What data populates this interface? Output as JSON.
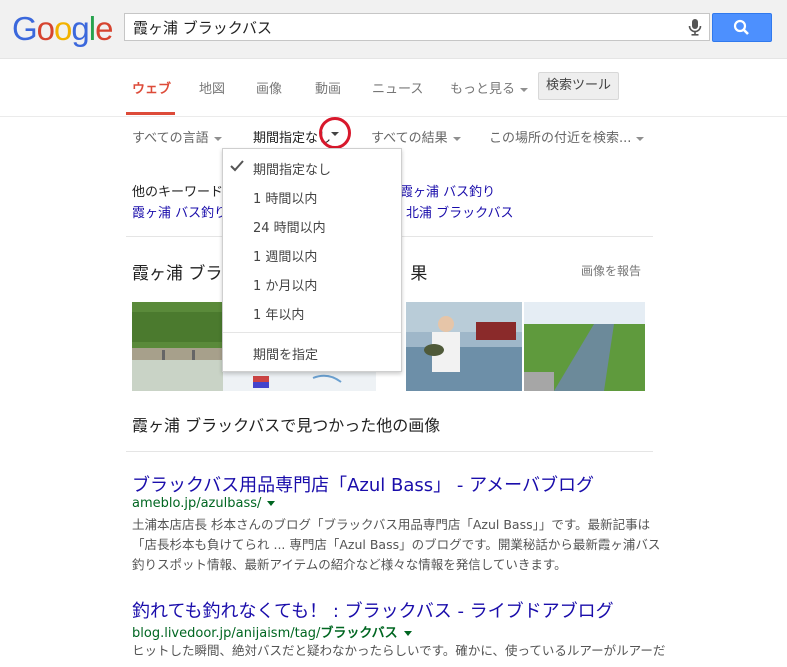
{
  "logo": {
    "letters": [
      "G",
      "o",
      "o",
      "g",
      "l",
      "e"
    ],
    "colors": [
      "#3b68dc",
      "#d6442f",
      "#f2b200",
      "#3b68dc",
      "#27a24d",
      "#d6442f"
    ]
  },
  "search": {
    "query": "霞ヶ浦 ブラックバス"
  },
  "tabs": [
    {
      "label": "ウェブ",
      "active": true
    },
    {
      "label": "地図"
    },
    {
      "label": "画像"
    },
    {
      "label": "動画"
    },
    {
      "label": "ニュース"
    },
    {
      "label": "もっと見る"
    }
  ],
  "tools_button": "検索ツール",
  "tool_filters": {
    "language": "すべての言語",
    "period": "期間指定なし",
    "results": "すべての結果",
    "location": "この場所の付近を検索..."
  },
  "period_menu": {
    "items": [
      "期間指定なし",
      "1 時間以内",
      "24 時間以内",
      "1 週間以内",
      "1 か月以内",
      "1 年以内"
    ],
    "custom": "期間を指定",
    "selected_index": 0
  },
  "related": {
    "label": "他のキーワード:",
    "items": [
      "霞ヶ浦 バス釣り",
      "霞ヶ浦 バス釣り",
      "北浦 ブラックバス"
    ]
  },
  "images": {
    "title_left": "霞ヶ浦 ブラ",
    "title_right": "果",
    "report": "画像を報告",
    "more": "霞ヶ浦 ブラックバスで見つかった他の画像"
  },
  "results": [
    {
      "title": "ブラックバス用品専門店「Azul Bass」 - アメーバブログ",
      "url": "ameblo.jp/azulbass/",
      "snippet": [
        "土浦本店店長 杉本さんのブログ「ブラックバス用品専門店「Azul Bass」」です。最新記事は",
        "「店長杉本も負けてられ ... 専門店「Azul Bass」のブログです。開業秘話から最新霞ヶ浦バス",
        "釣りスポット情報、最新アイテムの紹介など様々な情報を発信していきます。"
      ]
    },
    {
      "title": "釣れても釣れなくても！ : ブラックバス - ライブドアブログ",
      "url_plain": "blog.livedoor.jp/anijaism/tag/",
      "url_bold": "ブラックバス",
      "snippet": [
        "ヒットした瞬間、絶対バスだと疑わなかったらしいです。確かに、使っているルアーがルアーだ"
      ]
    }
  ]
}
